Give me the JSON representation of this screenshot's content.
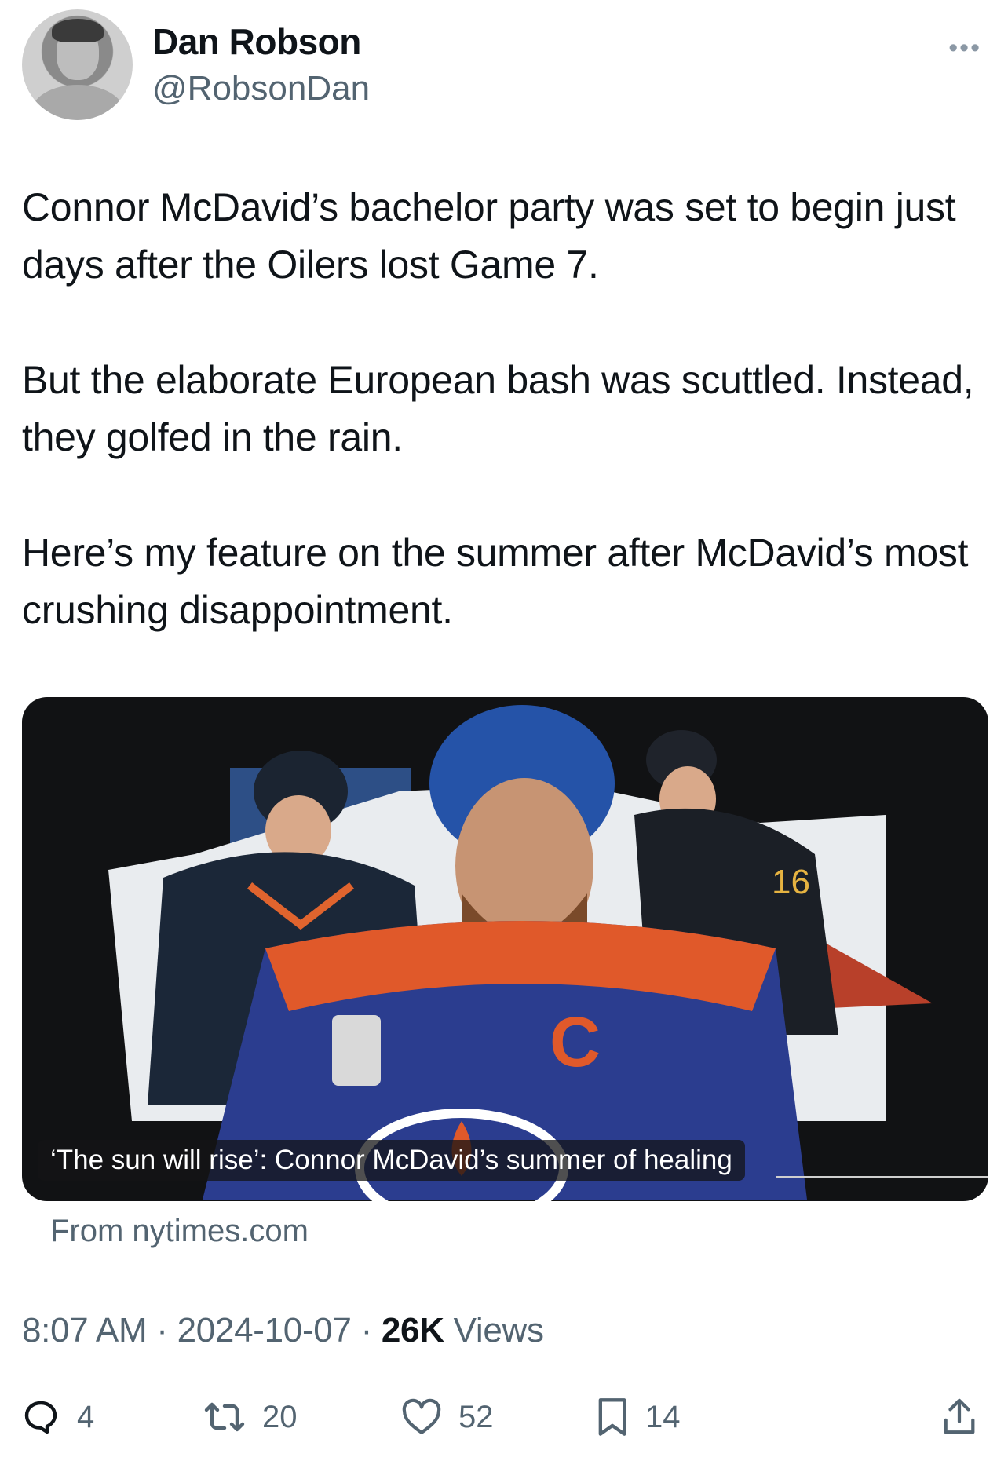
{
  "author": {
    "name": "Dan Robson",
    "handle": "@RobsonDan",
    "avatar_icon": "profile-photo"
  },
  "tweet": {
    "paragraphs": [
      "Connor McDavid’s bachelor party was set to begin just days after the Oilers lost Game 7.",
      "But the elaborate European bash was scuttled. Instead, they golfed in the rain.",
      "Here’s my feature on the summer after  McDavid’s most crushing disappointment."
    ]
  },
  "card": {
    "title": "‘The sun will rise’: Connor McDavid’s summer of healing",
    "source": "From nytimes.com"
  },
  "meta": {
    "time": "8:07 AM",
    "date": "2024-10-07",
    "views_count": "26K",
    "views_label": "Views",
    "separator": "·"
  },
  "actions": {
    "replies": "4",
    "reposts": "20",
    "likes": "52",
    "bookmarks": "14"
  },
  "more_icon": "more-horizontal-icon"
}
